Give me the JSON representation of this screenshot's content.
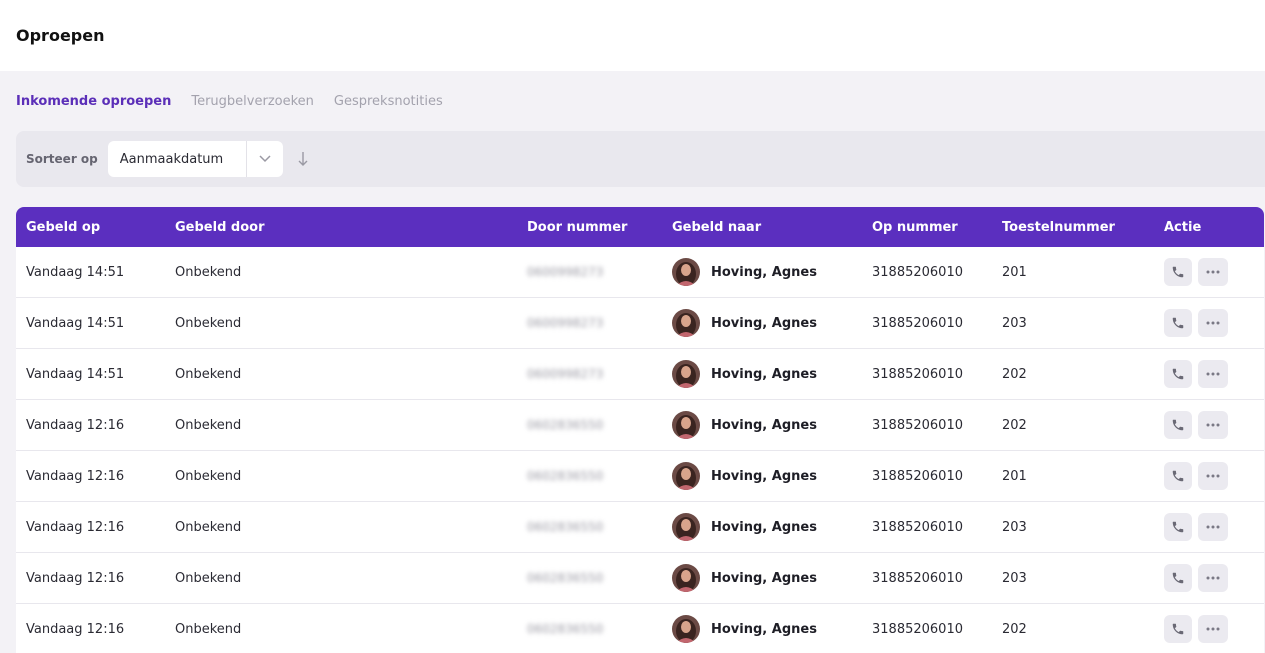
{
  "header": {
    "title": "Oproepen"
  },
  "tabs": [
    {
      "label": "Inkomende oproepen",
      "active": true
    },
    {
      "label": "Terugbelverzoeken",
      "active": false
    },
    {
      "label": "Gespreksnotities",
      "active": false
    }
  ],
  "sort": {
    "label": "Sorteer op",
    "value": "Aanmaakdatum",
    "direction_icon": "arrow-down-icon"
  },
  "table": {
    "columns": [
      "Gebeld op",
      "Gebeld door",
      "Door nummer",
      "Gebeld naar",
      "Op nummer",
      "Toestelnummer",
      "Actie"
    ],
    "rows": [
      {
        "time": "Vandaag 14:51",
        "caller": "Onbekend",
        "number": "0600998273",
        "callee": "Hoving, Agnes",
        "to_number": "31885206010",
        "extension": "201"
      },
      {
        "time": "Vandaag 14:51",
        "caller": "Onbekend",
        "number": "0600998273",
        "callee": "Hoving, Agnes",
        "to_number": "31885206010",
        "extension": "203"
      },
      {
        "time": "Vandaag 14:51",
        "caller": "Onbekend",
        "number": "0600998273",
        "callee": "Hoving, Agnes",
        "to_number": "31885206010",
        "extension": "202"
      },
      {
        "time": "Vandaag 12:16",
        "caller": "Onbekend",
        "number": "0602836550",
        "callee": "Hoving, Agnes",
        "to_number": "31885206010",
        "extension": "202"
      },
      {
        "time": "Vandaag 12:16",
        "caller": "Onbekend",
        "number": "0602836550",
        "callee": "Hoving, Agnes",
        "to_number": "31885206010",
        "extension": "201"
      },
      {
        "time": "Vandaag 12:16",
        "caller": "Onbekend",
        "number": "0602836550",
        "callee": "Hoving, Agnes",
        "to_number": "31885206010",
        "extension": "203"
      },
      {
        "time": "Vandaag 12:16",
        "caller": "Onbekend",
        "number": "0602836550",
        "callee": "Hoving, Agnes",
        "to_number": "31885206010",
        "extension": "203"
      },
      {
        "time": "Vandaag 12:16",
        "caller": "Onbekend",
        "number": "0602836550",
        "callee": "Hoving, Agnes",
        "to_number": "31885206010",
        "extension": "202"
      }
    ]
  },
  "colors": {
    "accent": "#5b2fbf",
    "active_tab": "#5b2fb8",
    "background": "#f3f2f6"
  }
}
